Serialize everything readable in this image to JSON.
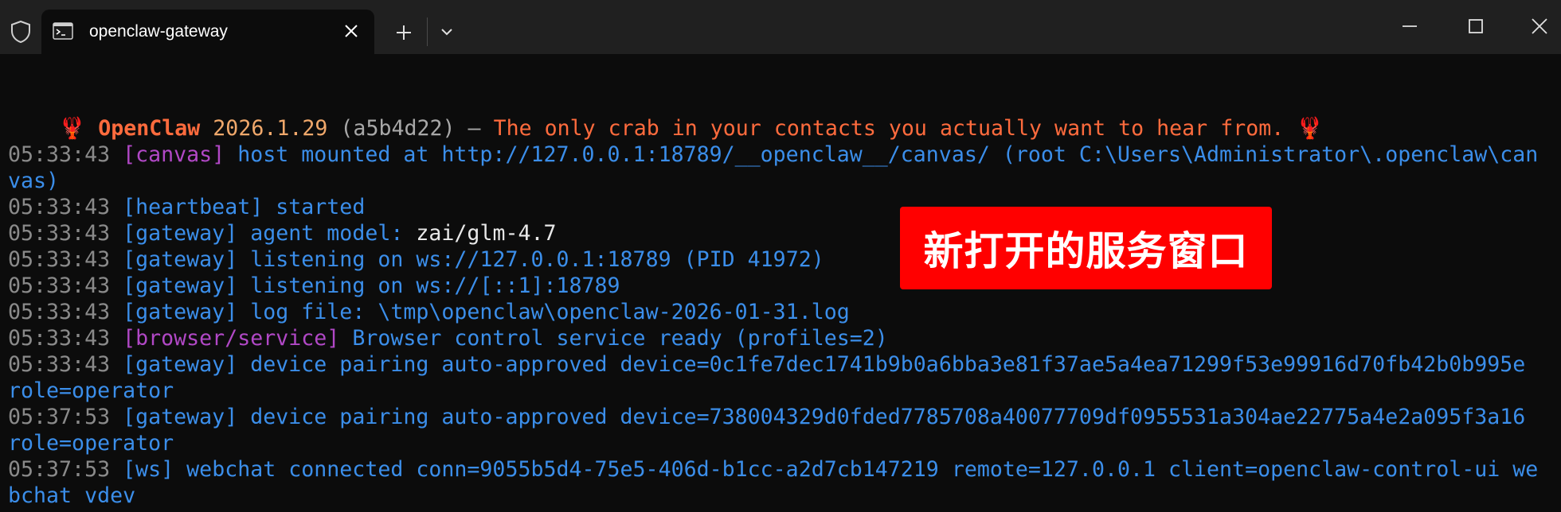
{
  "window": {
    "tab_title": "openclaw-gateway",
    "icons": {
      "shield": "shield-icon",
      "terminal": "terminal-icon",
      "close_tab": "close-icon",
      "new_tab": "plus-icon",
      "dropdown": "chevron-down-icon",
      "minimize": "minimize-icon",
      "maximize": "maximize-icon",
      "close_window": "close-icon"
    }
  },
  "banner": {
    "crab": "🦞",
    "name": "OpenClaw",
    "version": "2026.1.29",
    "commit": "(a5b4d22)",
    "dash": "—",
    "tagline": "The only crab in your contacts you actually want to hear from.",
    "crab_end": "🦞"
  },
  "log": [
    {
      "ts": "05:33:43",
      "tag": "[canvas]",
      "msg": "host mounted at http://127.0.0.1:18789/__openclaw__/canvas/ (root C:\\Users\\Administrator\\.openclaw\\can",
      "cont": "vas)"
    },
    {
      "ts": "05:33:43",
      "tag": "[heartbeat]",
      "msg": "started"
    },
    {
      "ts": "05:33:43",
      "tag": "[gateway]",
      "msg": "agent model:",
      "value": "zai/glm-4.7"
    },
    {
      "ts": "05:33:43",
      "tag": "[gateway]",
      "msg": "listening on ws://127.0.0.1:18789 (PID 41972)"
    },
    {
      "ts": "05:33:43",
      "tag": "[gateway]",
      "msg": "listening on ws://[::1]:18789"
    },
    {
      "ts": "05:33:43",
      "tag": "[gateway]",
      "msg": "log file: \\tmp\\openclaw\\openclaw-2026-01-31.log"
    },
    {
      "ts": "05:33:43",
      "tag": "[browser/service]",
      "msg": "Browser control service ready (profiles=2)"
    },
    {
      "ts": "05:33:43",
      "tag": "[gateway]",
      "msg": "device pairing auto-approved device=0c1fe7dec1741b9b0a6bba3e81f37ae5a4ea71299f53e99916d70fb42b0b995e",
      "cont": "role=operator"
    },
    {
      "ts": "05:37:53",
      "tag": "[gateway]",
      "msg": "device pairing auto-approved device=738004329d0fded7785708a40077709df0955531a304ae22775a4e2a095f3a16",
      "cont": "role=operator"
    },
    {
      "ts": "05:37:53",
      "tag": "[ws]",
      "msg": "webchat connected conn=9055b5d4-75e5-406d-b1cc-a2d7cb147219 remote=127.0.0.1 client=openclaw-control-ui we",
      "cont": "bchat vdev"
    }
  ],
  "overlay_label": "新打开的服务窗口"
}
